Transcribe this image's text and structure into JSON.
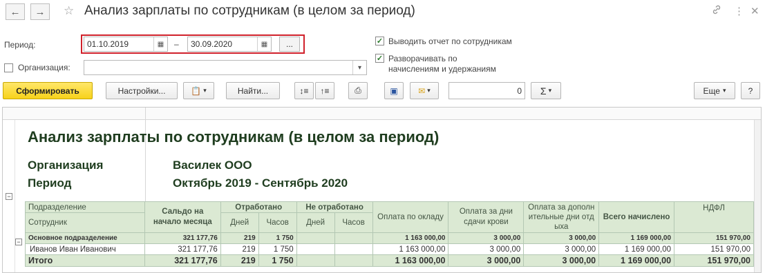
{
  "window": {
    "title": "Анализ зарплаты по сотрудникам (в целом за период)",
    "back_icon": "←",
    "forward_icon": "→",
    "star_icon": "☆",
    "link_icon": "🔗",
    "menu_icon": "⋮",
    "close_icon": "✕"
  },
  "form": {
    "period_label": "Период:",
    "date_from": "01.10.2019",
    "date_to": "30.09.2020",
    "dash": "–",
    "period_button": "...",
    "org_label": "Организация:",
    "org_value": "",
    "by_employees_label": "Выводить отчет по сотрудникам",
    "by_employees_checked": true,
    "expand_label_1": "Разворачивать по",
    "expand_label_2": "начислениям и удержаниям",
    "expand_checked": true,
    "org_checked": false,
    "highlight_color": "#d0202a"
  },
  "toolbar": {
    "generate": "Сформировать",
    "settings": "Настройки...",
    "find": "Найти...",
    "sum_value": "0",
    "sum_symbol": "Σ",
    "more": "Еще",
    "help": "?"
  },
  "report": {
    "title": "Анализ зарплаты по сотрудникам (в целом за период)",
    "org_label": "Организация",
    "org_value": "Василек ООО",
    "period_label": "Период",
    "period_value": "Октябрь 2019 - Сентябрь 2020",
    "headers": {
      "division": "Подразделение",
      "employee": "Сотрудник",
      "opening_balance": "Сальдо на начало месяца",
      "worked": "Отработано",
      "not_worked": "Не отработано",
      "days": "Дней",
      "hours": "Часов",
      "salary_pay": "Оплата по окладу",
      "blood_days_pay": "Оплата за дни сдачи крови",
      "rest_days_pay": "Оплата за дополнительные дни отдыха",
      "total_accrued": "Всего начислено",
      "ndfl": "НДФЛ"
    },
    "rows": [
      {
        "kind": "group",
        "name": "Основное подразделение",
        "balance": "321 177,76",
        "w_days": "219",
        "w_hours": "1 750",
        "n_days": "",
        "n_hours": "",
        "salary": "1 163 000,00",
        "blood": "3 000,00",
        "rest": "3 000,00",
        "total": "1 169 000,00",
        "ndfl": "151 970,00"
      },
      {
        "kind": "employee",
        "name": "Иванов Иван Иванович",
        "balance": "321 177,76",
        "w_days": "219",
        "w_hours": "1 750",
        "n_days": "",
        "n_hours": "",
        "salary": "1 163 000,00",
        "blood": "3 000,00",
        "rest": "3 000,00",
        "total": "1 169 000,00",
        "ndfl": "151 970,00"
      },
      {
        "kind": "total",
        "name": "Итого",
        "balance": "321 177,76",
        "w_days": "219",
        "w_hours": "1 750",
        "n_days": "",
        "n_hours": "",
        "salary": "1 163 000,00",
        "blood": "3 000,00",
        "rest": "3 000,00",
        "total": "1 169 000,00",
        "ndfl": "151 970,00"
      }
    ]
  }
}
